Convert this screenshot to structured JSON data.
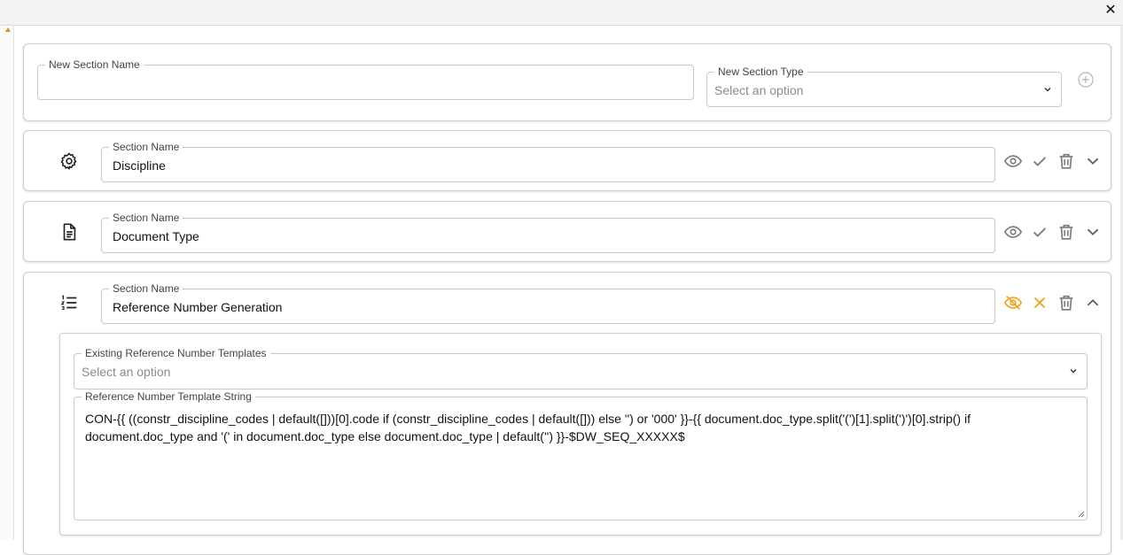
{
  "window": {
    "close_glyph": "✕"
  },
  "new_section": {
    "name_label": "New Section Name",
    "name_value": "",
    "type_label": "New Section Type",
    "type_placeholder": "Select an option",
    "add_icon": "plus-circle-icon"
  },
  "sections": [
    {
      "icon": "gear-icon",
      "name_label": "Section Name",
      "name_value": "Discipline",
      "actions": [
        "eye-icon",
        "check-icon",
        "trash-icon",
        "chevron-down-icon"
      ]
    },
    {
      "icon": "document-icon",
      "name_label": "Section Name",
      "name_value": "Document Type",
      "actions": [
        "eye-icon",
        "check-icon",
        "trash-icon",
        "chevron-down-icon"
      ]
    },
    {
      "icon": "numbered-list-icon",
      "name_label": "Section Name",
      "name_value": "Reference Number Generation",
      "actions": [
        "eye-off-icon",
        "close-icon",
        "trash-icon",
        "chevron-up-icon"
      ],
      "expanded": {
        "templates_label": "Existing Reference Number Templates",
        "templates_placeholder": "Select an option",
        "template_string_label": "Reference Number Template String",
        "template_string_value": "CON-{{ ((constr_discipline_codes | default([]))[0].code if (constr_discipline_codes | default([])) else '') or '000' }}-{{ document.doc_type.split('(')[1].split(')')[0].strip() if document.doc_type and '(' in document.doc_type else document.doc_type | default('') }}-$DW_SEQ_XXXXX$"
      }
    }
  ],
  "colors": {
    "accent": "#f0a21b",
    "icon_gray": "#7a7a7a",
    "border": "#c9c9c9"
  }
}
